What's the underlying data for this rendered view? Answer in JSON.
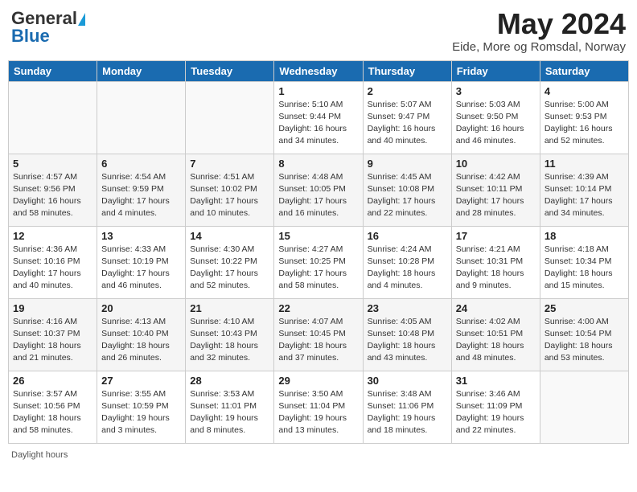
{
  "header": {
    "logo_general": "General",
    "logo_blue": "Blue",
    "month_year": "May 2024",
    "location": "Eide, More og Romsdal, Norway"
  },
  "calendar": {
    "days_of_week": [
      "Sunday",
      "Monday",
      "Tuesday",
      "Wednesday",
      "Thursday",
      "Friday",
      "Saturday"
    ],
    "weeks": [
      [
        {
          "day": "",
          "info": ""
        },
        {
          "day": "",
          "info": ""
        },
        {
          "day": "",
          "info": ""
        },
        {
          "day": "1",
          "info": "Sunrise: 5:10 AM\nSunset: 9:44 PM\nDaylight: 16 hours\nand 34 minutes."
        },
        {
          "day": "2",
          "info": "Sunrise: 5:07 AM\nSunset: 9:47 PM\nDaylight: 16 hours\nand 40 minutes."
        },
        {
          "day": "3",
          "info": "Sunrise: 5:03 AM\nSunset: 9:50 PM\nDaylight: 16 hours\nand 46 minutes."
        },
        {
          "day": "4",
          "info": "Sunrise: 5:00 AM\nSunset: 9:53 PM\nDaylight: 16 hours\nand 52 minutes."
        }
      ],
      [
        {
          "day": "5",
          "info": "Sunrise: 4:57 AM\nSunset: 9:56 PM\nDaylight: 16 hours\nand 58 minutes."
        },
        {
          "day": "6",
          "info": "Sunrise: 4:54 AM\nSunset: 9:59 PM\nDaylight: 17 hours\nand 4 minutes."
        },
        {
          "day": "7",
          "info": "Sunrise: 4:51 AM\nSunset: 10:02 PM\nDaylight: 17 hours\nand 10 minutes."
        },
        {
          "day": "8",
          "info": "Sunrise: 4:48 AM\nSunset: 10:05 PM\nDaylight: 17 hours\nand 16 minutes."
        },
        {
          "day": "9",
          "info": "Sunrise: 4:45 AM\nSunset: 10:08 PM\nDaylight: 17 hours\nand 22 minutes."
        },
        {
          "day": "10",
          "info": "Sunrise: 4:42 AM\nSunset: 10:11 PM\nDaylight: 17 hours\nand 28 minutes."
        },
        {
          "day": "11",
          "info": "Sunrise: 4:39 AM\nSunset: 10:14 PM\nDaylight: 17 hours\nand 34 minutes."
        }
      ],
      [
        {
          "day": "12",
          "info": "Sunrise: 4:36 AM\nSunset: 10:16 PM\nDaylight: 17 hours\nand 40 minutes."
        },
        {
          "day": "13",
          "info": "Sunrise: 4:33 AM\nSunset: 10:19 PM\nDaylight: 17 hours\nand 46 minutes."
        },
        {
          "day": "14",
          "info": "Sunrise: 4:30 AM\nSunset: 10:22 PM\nDaylight: 17 hours\nand 52 minutes."
        },
        {
          "day": "15",
          "info": "Sunrise: 4:27 AM\nSunset: 10:25 PM\nDaylight: 17 hours\nand 58 minutes."
        },
        {
          "day": "16",
          "info": "Sunrise: 4:24 AM\nSunset: 10:28 PM\nDaylight: 18 hours\nand 4 minutes."
        },
        {
          "day": "17",
          "info": "Sunrise: 4:21 AM\nSunset: 10:31 PM\nDaylight: 18 hours\nand 9 minutes."
        },
        {
          "day": "18",
          "info": "Sunrise: 4:18 AM\nSunset: 10:34 PM\nDaylight: 18 hours\nand 15 minutes."
        }
      ],
      [
        {
          "day": "19",
          "info": "Sunrise: 4:16 AM\nSunset: 10:37 PM\nDaylight: 18 hours\nand 21 minutes."
        },
        {
          "day": "20",
          "info": "Sunrise: 4:13 AM\nSunset: 10:40 PM\nDaylight: 18 hours\nand 26 minutes."
        },
        {
          "day": "21",
          "info": "Sunrise: 4:10 AM\nSunset: 10:43 PM\nDaylight: 18 hours\nand 32 minutes."
        },
        {
          "day": "22",
          "info": "Sunrise: 4:07 AM\nSunset: 10:45 PM\nDaylight: 18 hours\nand 37 minutes."
        },
        {
          "day": "23",
          "info": "Sunrise: 4:05 AM\nSunset: 10:48 PM\nDaylight: 18 hours\nand 43 minutes."
        },
        {
          "day": "24",
          "info": "Sunrise: 4:02 AM\nSunset: 10:51 PM\nDaylight: 18 hours\nand 48 minutes."
        },
        {
          "day": "25",
          "info": "Sunrise: 4:00 AM\nSunset: 10:54 PM\nDaylight: 18 hours\nand 53 minutes."
        }
      ],
      [
        {
          "day": "26",
          "info": "Sunrise: 3:57 AM\nSunset: 10:56 PM\nDaylight: 18 hours\nand 58 minutes."
        },
        {
          "day": "27",
          "info": "Sunrise: 3:55 AM\nSunset: 10:59 PM\nDaylight: 19 hours\nand 3 minutes."
        },
        {
          "day": "28",
          "info": "Sunrise: 3:53 AM\nSunset: 11:01 PM\nDaylight: 19 hours\nand 8 minutes."
        },
        {
          "day": "29",
          "info": "Sunrise: 3:50 AM\nSunset: 11:04 PM\nDaylight: 19 hours\nand 13 minutes."
        },
        {
          "day": "30",
          "info": "Sunrise: 3:48 AM\nSunset: 11:06 PM\nDaylight: 19 hours\nand 18 minutes."
        },
        {
          "day": "31",
          "info": "Sunrise: 3:46 AM\nSunset: 11:09 PM\nDaylight: 19 hours\nand 22 minutes."
        },
        {
          "day": "",
          "info": ""
        }
      ]
    ]
  },
  "footer": {
    "daylight_hours": "Daylight hours"
  }
}
